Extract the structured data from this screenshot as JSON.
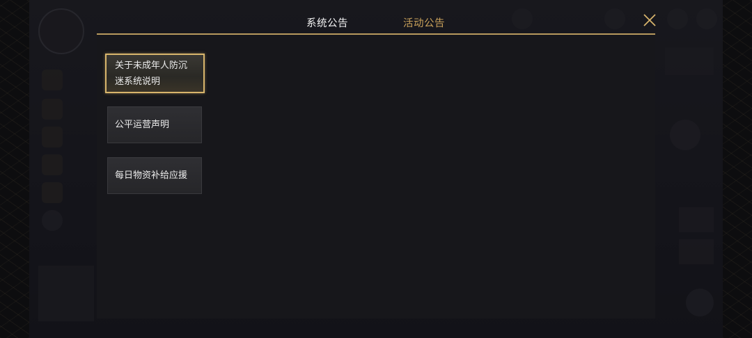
{
  "tabs": {
    "system": "系统公告",
    "activity": "活动公告"
  },
  "announcements": [
    {
      "title": "关于未成年人防沉迷系统说明",
      "active": true
    },
    {
      "title": "公平运营声明",
      "active": false
    },
    {
      "title": "每日物资补给应援",
      "active": false
    }
  ],
  "colors": {
    "accent_gold": "#c9a15a",
    "border_gold": "#d8b56c",
    "panel_bg": "#17171b"
  },
  "icons": {
    "close": "close-icon"
  }
}
